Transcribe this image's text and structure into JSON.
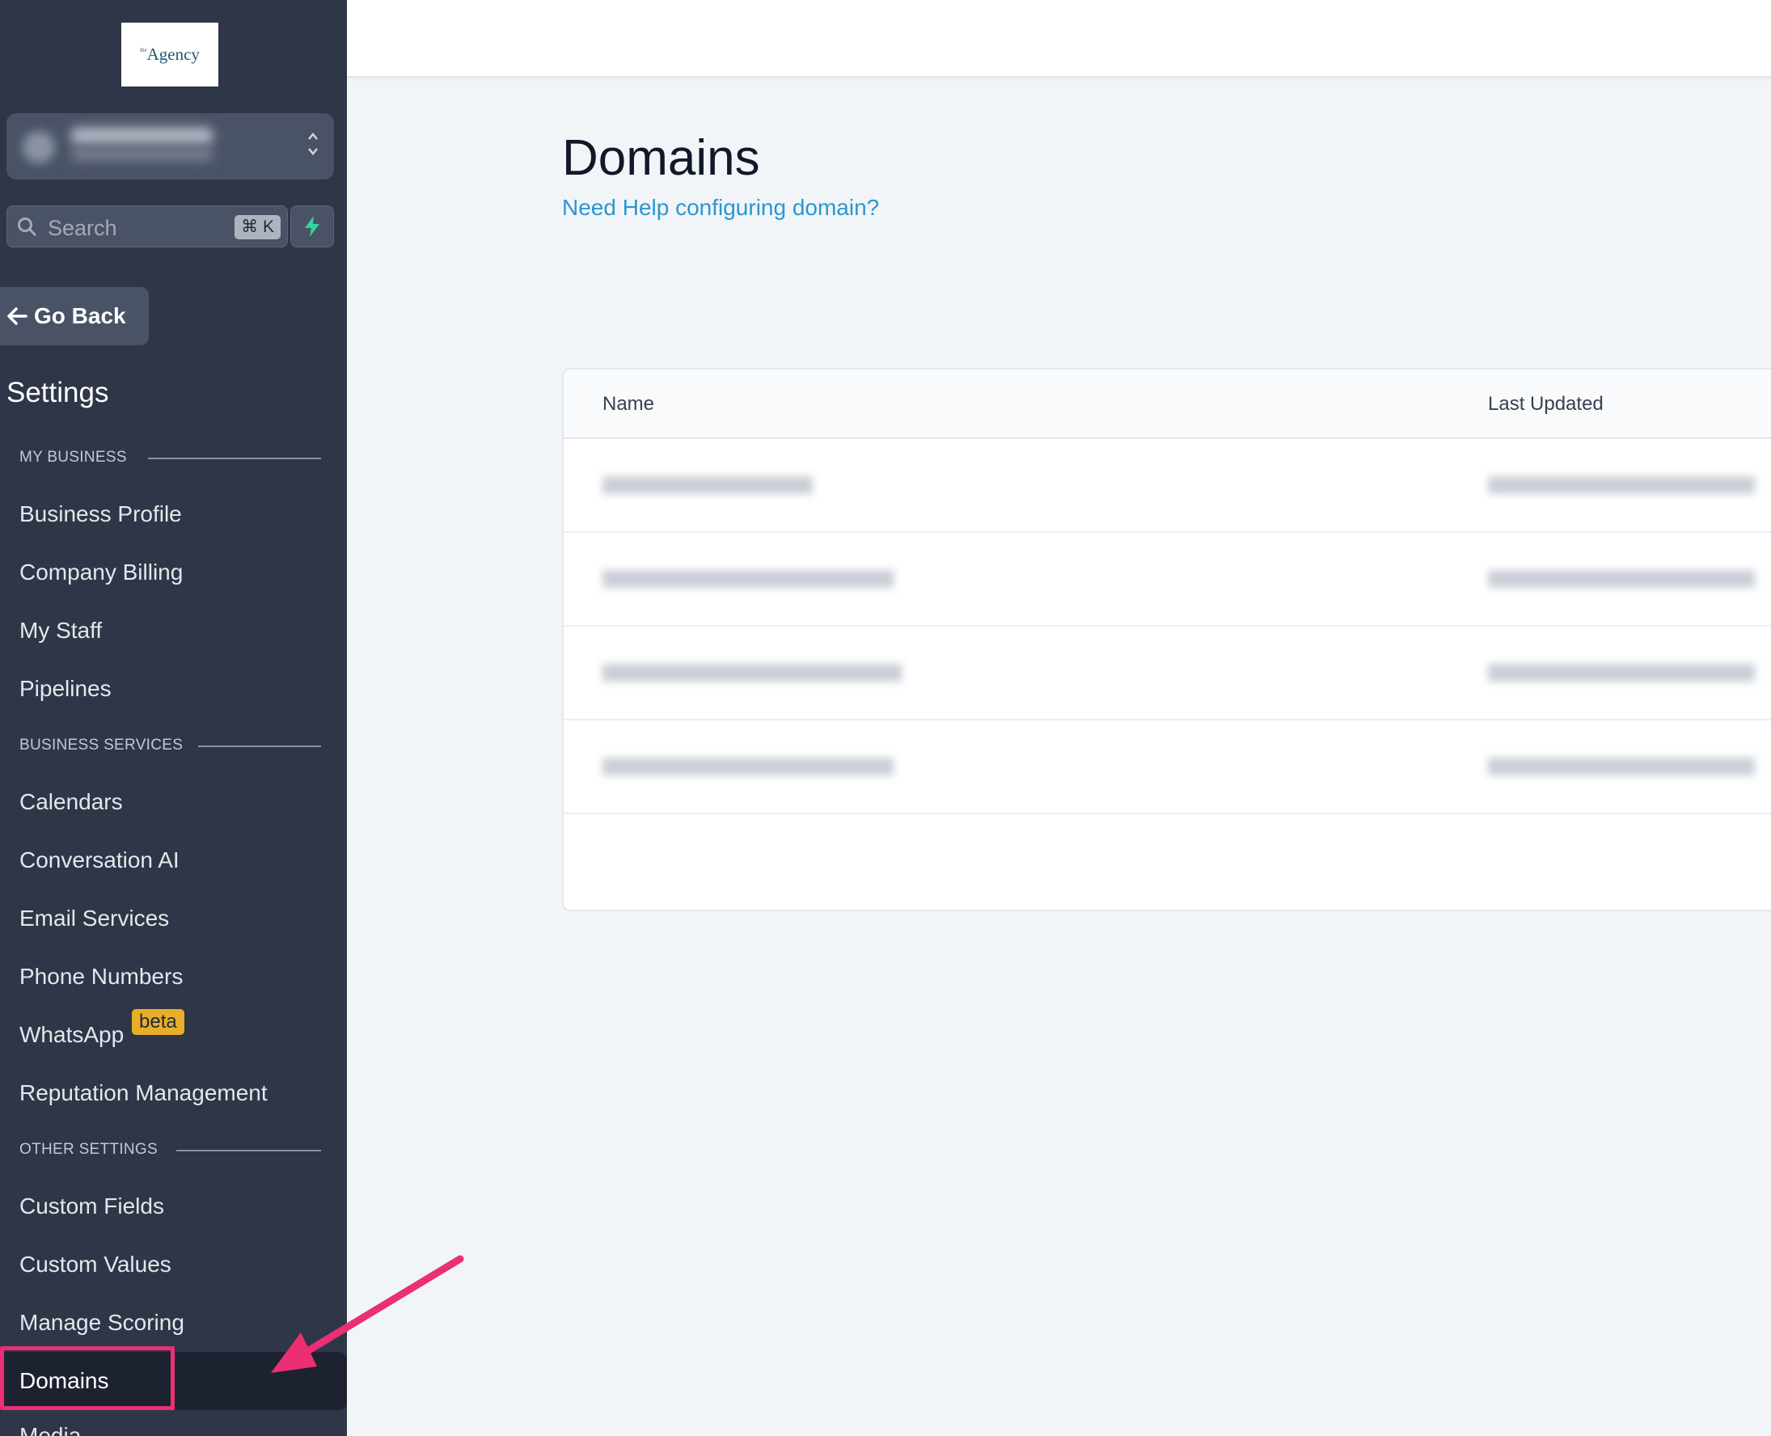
{
  "sidebar": {
    "logo": {
      "small_text": "the",
      "main_text": "Agency"
    },
    "search": {
      "placeholder": "Search",
      "shortcut": "⌘ K"
    },
    "go_back_label": "Go Back",
    "settings_title": "Settings",
    "sections": {
      "my_business": "MY BUSINESS",
      "business_services": "BUSINESS SERVICES",
      "other_settings": "OTHER SETTINGS"
    },
    "items": {
      "business_profile": "Business Profile",
      "company_billing": "Company Billing",
      "my_staff": "My Staff",
      "pipelines": "Pipelines",
      "calendars": "Calendars",
      "conversation_ai": "Conversation AI",
      "email_services": "Email Services",
      "phone_numbers": "Phone Numbers",
      "whatsapp": "WhatsApp",
      "reputation_management": "Reputation Management",
      "custom_fields": "Custom Fields",
      "custom_values": "Custom Values",
      "manage_scoring": "Manage Scoring",
      "domains": "Domains",
      "media": "Media"
    },
    "whatsapp_badge": "beta",
    "active_item": "Domains"
  },
  "main": {
    "title": "Domains",
    "help_link": "Need Help configuring domain?",
    "table": {
      "columns": [
        "Name",
        "Last Updated"
      ]
    }
  },
  "colors": {
    "sidebar_bg": "#2e3647",
    "accent_link": "#2b96d1",
    "highlight": "#ec2f72",
    "beta_badge": "#e8ae2a"
  }
}
